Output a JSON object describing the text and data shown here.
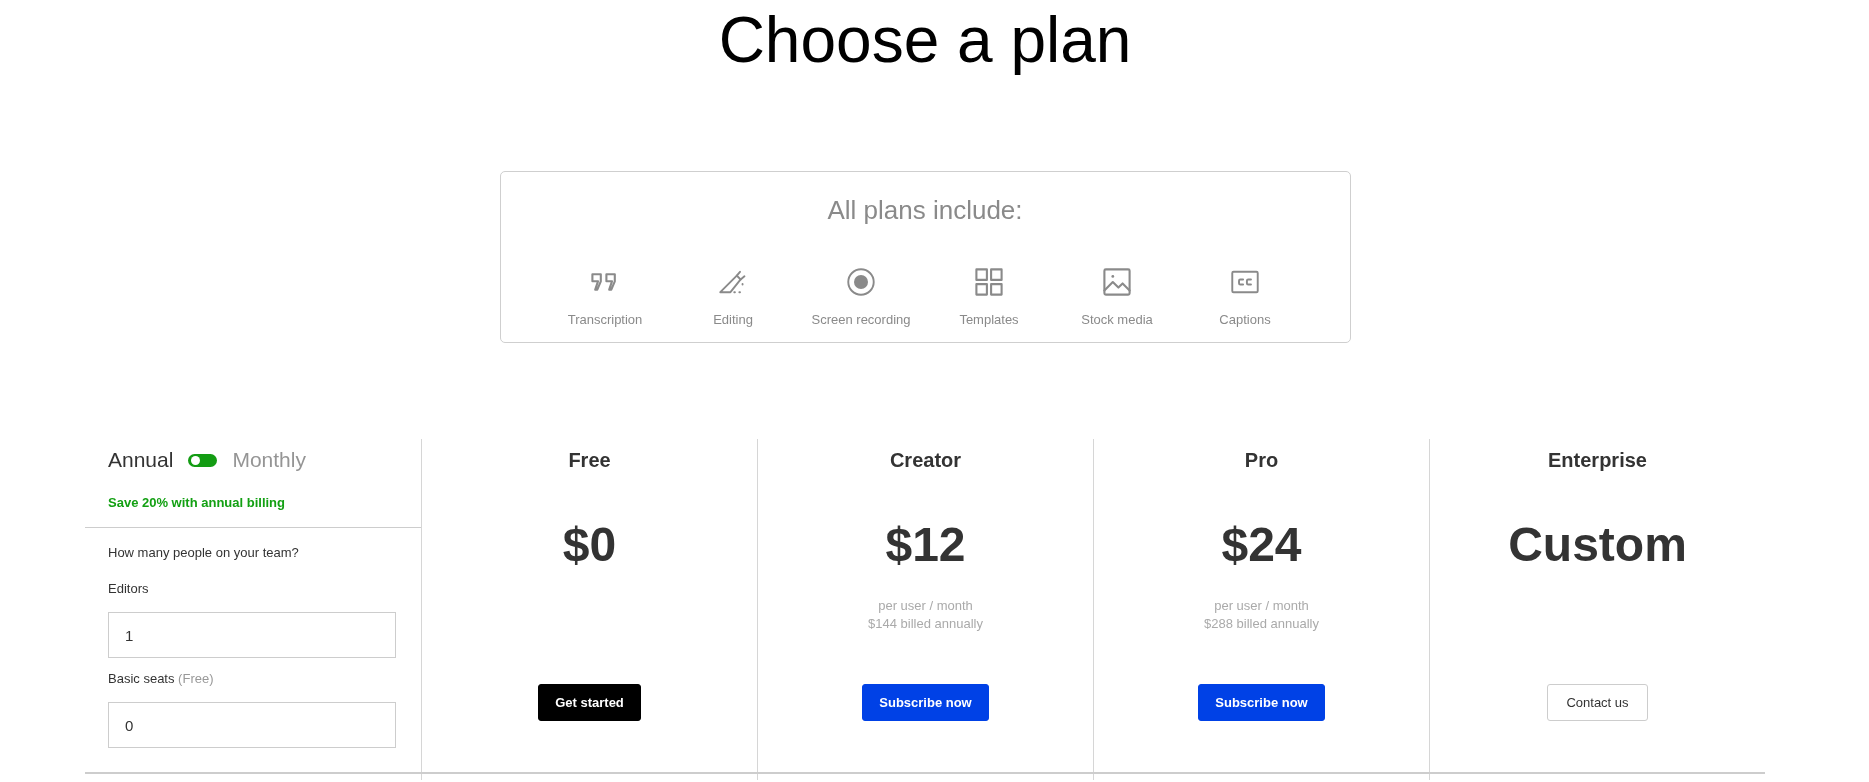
{
  "title": "Choose a plan",
  "features": {
    "heading": "All plans include:",
    "items": [
      {
        "kind": "quote",
        "label": "Transcription"
      },
      {
        "kind": "pencil",
        "label": "Editing"
      },
      {
        "kind": "record",
        "label": "Screen recording"
      },
      {
        "kind": "grid",
        "label": "Templates"
      },
      {
        "kind": "image",
        "label": "Stock media"
      },
      {
        "kind": "captions",
        "label": "Captions"
      }
    ]
  },
  "billing": {
    "options": [
      {
        "label": "Annual",
        "selected": true
      },
      {
        "label": "Monthly",
        "selected": false
      }
    ],
    "savings_note": "Save 20% with annual billing"
  },
  "team": {
    "question": "How many people on your team?",
    "fields": [
      {
        "label": "Editors",
        "value": "1"
      },
      {
        "label": "Basic seats",
        "note": "(Free)",
        "value": "0"
      }
    ]
  },
  "plans": [
    {
      "name": "Free",
      "price": "$0",
      "button": {
        "label": "Get started",
        "kind": "dark"
      }
    },
    {
      "name": "Creator",
      "price": "$12",
      "notes": [
        "per user / month",
        "$144 billed annually"
      ],
      "button": {
        "label": "Subscribe now",
        "kind": "primary"
      }
    },
    {
      "name": "Pro",
      "price": "$24",
      "notes": [
        "per user / month",
        "$288 billed annually"
      ],
      "button": {
        "label": "Subscribe now",
        "kind": "primary"
      }
    },
    {
      "name": "Enterprise",
      "price": "Custom",
      "button": {
        "label": "Contact us",
        "kind": "outline"
      }
    }
  ]
}
